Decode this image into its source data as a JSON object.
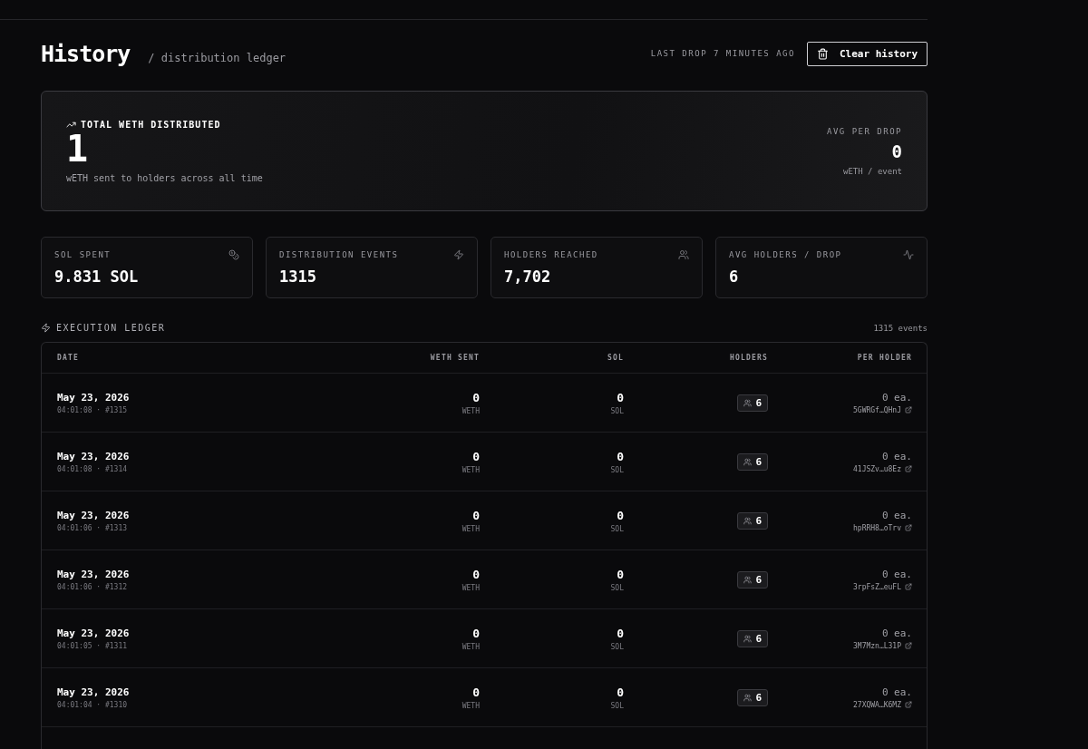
{
  "header": {
    "title": "History",
    "subtitle": "/ distribution ledger",
    "last_drop": "LAST DROP 7 MINUTES AGO",
    "clear_button": "Clear history"
  },
  "hero": {
    "label": "TOTAL WETH DISTRIBUTED",
    "value": "1",
    "caption": "wETH sent to holders across all time",
    "side_label": "AVG PER DROP",
    "side_value": "0",
    "side_caption": "wETH / event"
  },
  "stats": [
    {
      "label": "SOL SPENT",
      "value": "9.831 SOL"
    },
    {
      "label": "DISTRIBUTION EVENTS",
      "value": "1315"
    },
    {
      "label": "HOLDERS REACHED",
      "value": "7,702"
    },
    {
      "label": "AVG HOLDERS / DROP",
      "value": "6"
    }
  ],
  "ledger": {
    "title": "EXECUTION LEDGER",
    "count": "1315 events",
    "columns": [
      "DATE",
      "WETH SENT",
      "SOL",
      "HOLDERS",
      "PER HOLDER"
    ],
    "rows": [
      {
        "date": "May 23, 2026",
        "time": "04:01:08 · #1315",
        "weth": "0",
        "weth_unit": "WETH",
        "sol": "0",
        "sol_unit": "SOL",
        "holders": "6",
        "per_holder": "0 ea.",
        "tx": "5GWRGf…QHnJ"
      },
      {
        "date": "May 23, 2026",
        "time": "04:01:08 · #1314",
        "weth": "0",
        "weth_unit": "WETH",
        "sol": "0",
        "sol_unit": "SOL",
        "holders": "6",
        "per_holder": "0 ea.",
        "tx": "41JSZv…u8Ez"
      },
      {
        "date": "May 23, 2026",
        "time": "04:01:06 · #1313",
        "weth": "0",
        "weth_unit": "WETH",
        "sol": "0",
        "sol_unit": "SOL",
        "holders": "6",
        "per_holder": "0 ea.",
        "tx": "hpRRH8…oTrv"
      },
      {
        "date": "May 23, 2026",
        "time": "04:01:06 · #1312",
        "weth": "0",
        "weth_unit": "WETH",
        "sol": "0",
        "sol_unit": "SOL",
        "holders": "6",
        "per_holder": "0 ea.",
        "tx": "3rpFsZ…euFL"
      },
      {
        "date": "May 23, 2026",
        "time": "04:01:05 · #1311",
        "weth": "0",
        "weth_unit": "WETH",
        "sol": "0",
        "sol_unit": "SOL",
        "holders": "6",
        "per_holder": "0 ea.",
        "tx": "3M7Mzn…L31P"
      },
      {
        "date": "May 23, 2026",
        "time": "04:01:04 · #1310",
        "weth": "0",
        "weth_unit": "WETH",
        "sol": "0",
        "sol_unit": "SOL",
        "holders": "6",
        "per_holder": "0 ea.",
        "tx": "27XQWA…K6MZ"
      }
    ]
  }
}
